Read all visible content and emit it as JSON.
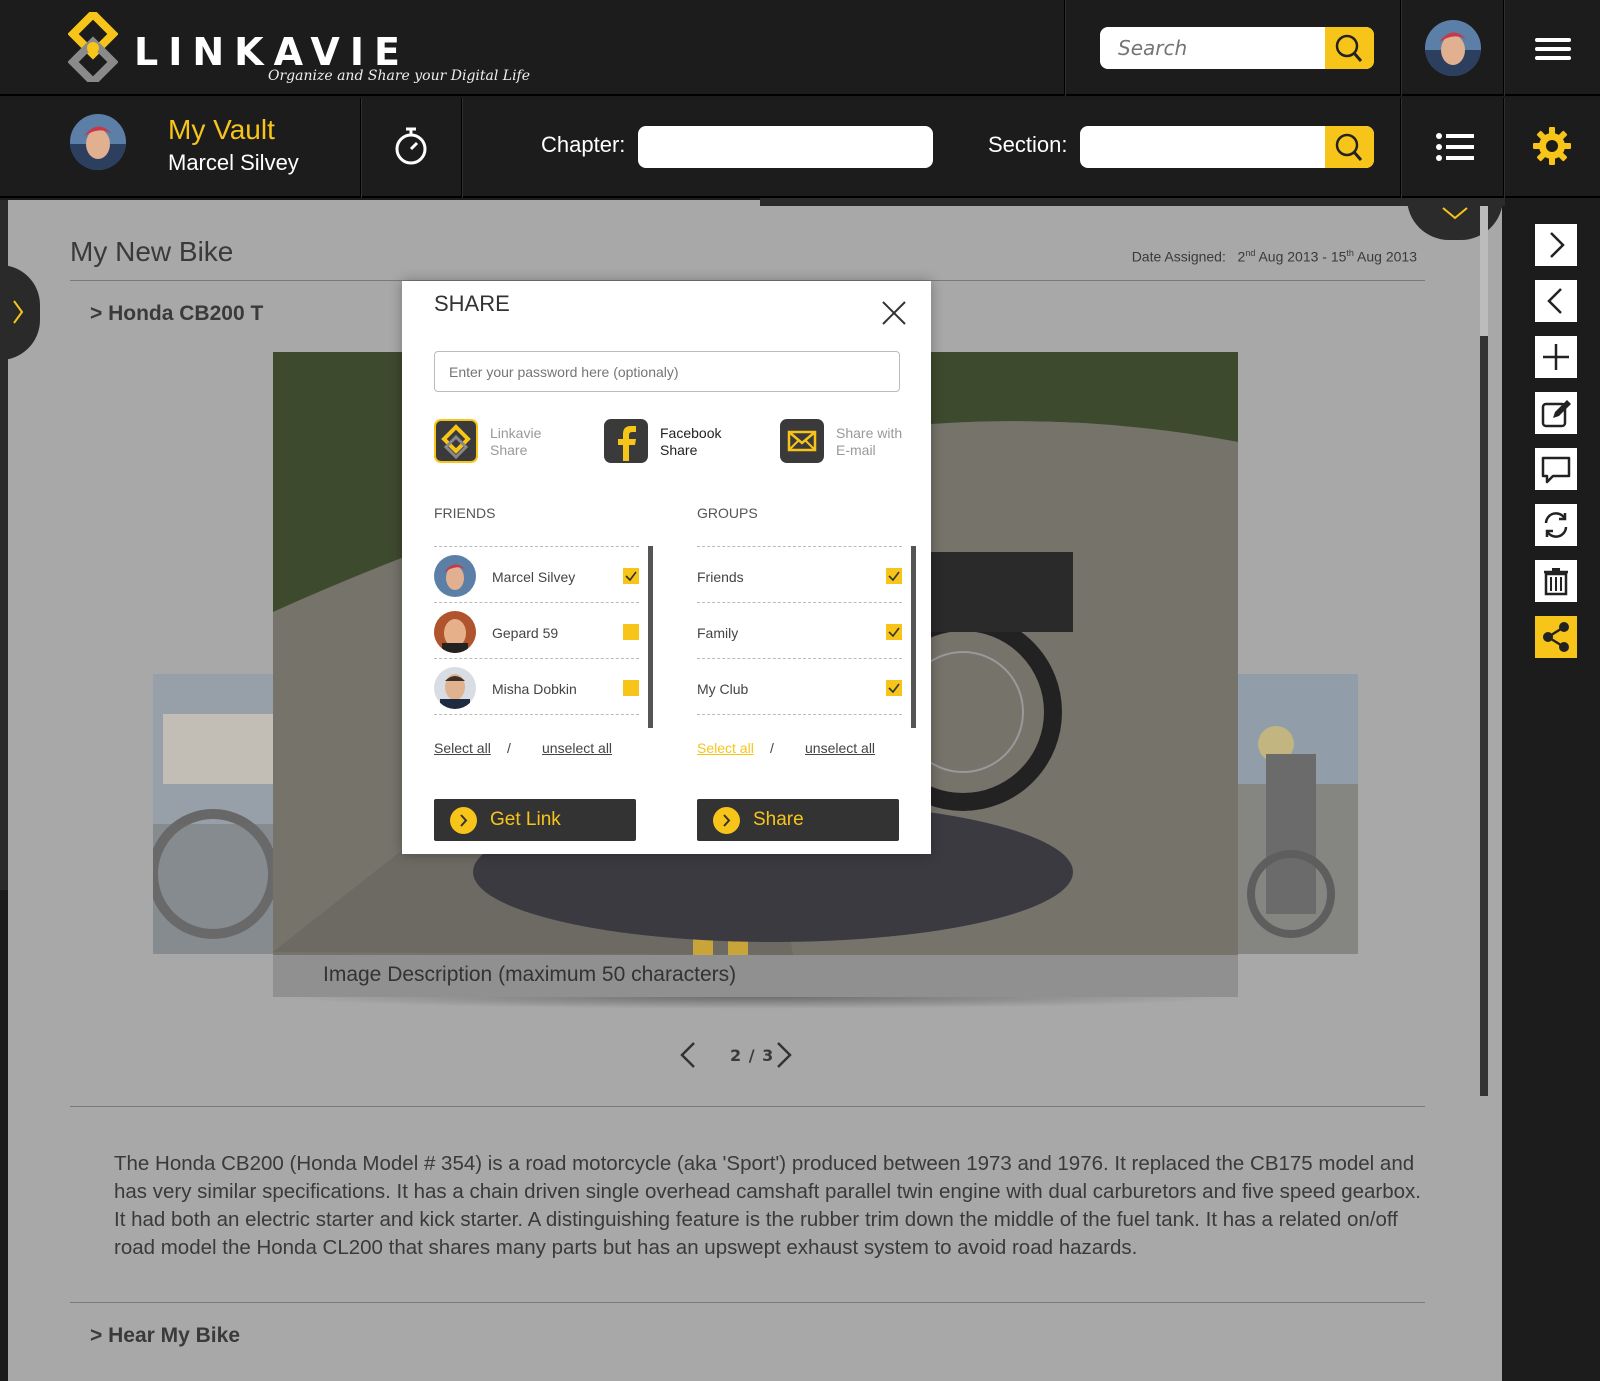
{
  "header": {
    "brand": "LINKAVIE",
    "tagline": "Organize and Share your Digital Life",
    "search_placeholder": "Search"
  },
  "subheader": {
    "vault_title": "My Vault",
    "user_name": "Marcel Silvey",
    "chapter_label": "Chapter:",
    "section_label": "Section:"
  },
  "page": {
    "title": "My New Bike",
    "date_prefix": "Date Assigned:",
    "date_from_day": "2",
    "date_from_sup": "nd",
    "date_from_rest": " Aug 2013 - 15",
    "date_to_sup": "th",
    "date_to_rest": " Aug 2013",
    "subhead_1": "> Honda CB200 T",
    "image_caption": "Image Description (maximum 50 characters)",
    "pager": "2 / 3",
    "description": "The Honda CB200 (Honda Model # 354) is a road motorcycle (aka 'Sport') produced between 1973 and 1976. It replaced the CB175 model and has very similar specifications. It has a chain driven single overhead camshaft parallel twin engine with dual carburetors and five speed gearbox. It had both an electric starter and kick starter. A distinguishing feature is the rubber trim down the middle of the fuel tank. It has a related on/off road model the Honda CL200 that shares many parts but has an upswept exhaust system to avoid road hazards.",
    "subhead_2": "> Hear My Bike"
  },
  "right_rail": {
    "icons": [
      "chevron-right-icon",
      "chevron-left-icon",
      "plus-icon",
      "edit-icon",
      "comment-icon",
      "refresh-icon",
      "trash-icon",
      "share-icon"
    ],
    "active": "share-icon"
  },
  "modal": {
    "title": "SHARE",
    "password_placeholder": "Enter your password here (optionaly)",
    "options": [
      {
        "line1": "Linkavie",
        "line2": "Share"
      },
      {
        "line1": "Facebook",
        "line2": "Share"
      },
      {
        "line1": "Share with",
        "line2": "E-mail"
      }
    ],
    "friends_heading": "FRIENDS",
    "groups_heading": "GROUPS",
    "friends": [
      {
        "name": "Marcel Silvey",
        "checked": true
      },
      {
        "name": "Gepard 59",
        "checked": false
      },
      {
        "name": "Misha Dobkin",
        "checked": false
      }
    ],
    "groups": [
      {
        "name": "Friends",
        "checked": true
      },
      {
        "name": "Family",
        "checked": true
      },
      {
        "name": "My Club",
        "checked": true
      }
    ],
    "select_all": "Select all",
    "unselect_all": "unselect all",
    "slash": "/",
    "get_link": "Get Link",
    "share": "Share"
  },
  "colors": {
    "accent": "#f7c51a",
    "bar": "#1c1c1c",
    "content_overlay": "#a8a8a8"
  }
}
